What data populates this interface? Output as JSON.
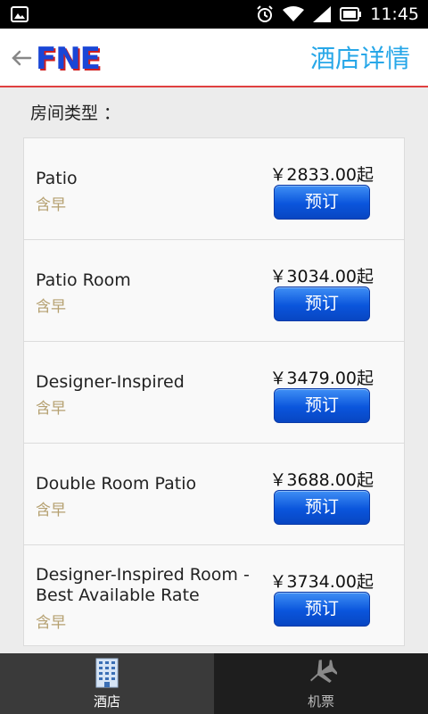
{
  "status_bar": {
    "time": "11:45",
    "icons": [
      "image-notification-icon",
      "alarm-icon",
      "wifi-icon",
      "signal-icon",
      "battery-icon"
    ]
  },
  "header": {
    "logo": "FNE",
    "title": "酒店详情"
  },
  "section_label": "房间类型 ：",
  "rooms": [
    {
      "name": "Patio",
      "sub": "含早",
      "price": "￥2833.00起",
      "button": "预订"
    },
    {
      "name": "Patio Room",
      "sub": "含早",
      "price": "￥3034.00起",
      "button": "预订"
    },
    {
      "name": "Designer-Inspired",
      "sub": "含早",
      "price": "￥3479.00起",
      "button": "预订"
    },
    {
      "name": "Double Room Patio",
      "sub": "含早",
      "price": "￥3688.00起",
      "button": "预订"
    },
    {
      "name": "Designer-Inspired Room - Best Available Rate",
      "sub": "含早",
      "price": "￥3734.00起",
      "button": "预订"
    }
  ],
  "tabs": [
    {
      "label": "酒店",
      "icon": "hotel-building-icon",
      "active": true
    },
    {
      "label": "机票",
      "icon": "airplane-icon",
      "active": false
    }
  ],
  "colors": {
    "accent_blue": "#27a7e8",
    "button_blue": "#0a55dc",
    "header_divider": "#e04040",
    "sub_text": "#b5a070"
  }
}
